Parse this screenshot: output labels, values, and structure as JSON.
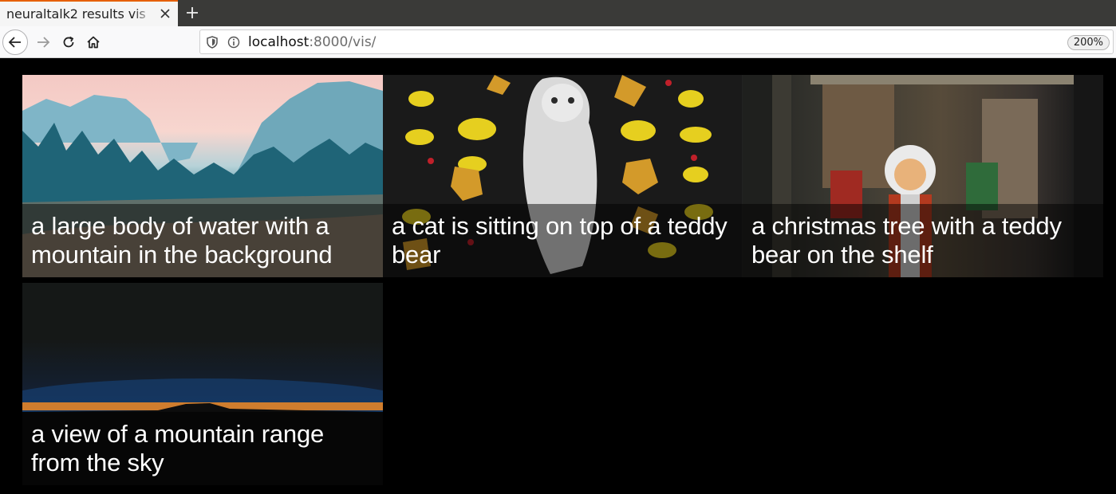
{
  "browser": {
    "tab_title": "neuraltalk2 results vis",
    "url_host": "localhost",
    "url_rest": ":8000/vis/",
    "zoom_level": "200%",
    "accent_color": "#e66000"
  },
  "results": [
    {
      "caption": "a large body of water with a mountain in the background"
    },
    {
      "caption": "a cat is sitting on top of a teddy bear"
    },
    {
      "caption": "a christmas tree with a teddy bear on the shelf"
    },
    {
      "caption": "a view of a mountain range from the sky"
    }
  ]
}
